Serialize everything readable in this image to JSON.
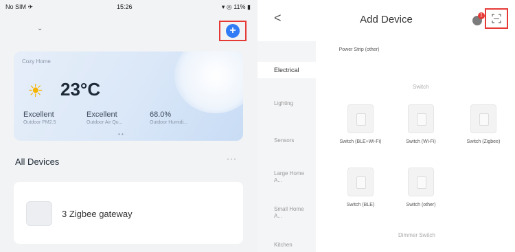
{
  "left": {
    "statusbar": {
      "left": "No SIM ✈",
      "time": "15:26",
      "right": "▾ ◎ 11% ▮"
    },
    "home_chevron": "⌄",
    "weather": {
      "home_label": "Cozy Home",
      "temperature": "23°C",
      "stats": [
        {
          "value": "Excellent",
          "label": "Outdoor PM2.5"
        },
        {
          "value": "Excellent",
          "label": "Outdoor Air Qu..."
        },
        {
          "value": "68.0%",
          "label": "Outdoor Humidi..."
        }
      ],
      "dots": "• •"
    },
    "all_devices_label": "All Devices",
    "more_label": "···",
    "devices": [
      {
        "name": "3 Zigbee gateway"
      }
    ]
  },
  "right": {
    "back": "<",
    "title": "Add Device",
    "badge": "1",
    "sidebar": [
      "Electrical",
      "Lighting",
      "Sensors",
      "Large Home A...",
      "Small Home A...",
      "Kitchen"
    ],
    "top_item": "Power Strip (other)",
    "section_switch": "Switch",
    "section_dimmer": "Dimmer Switch",
    "switch_items": [
      {
        "label": "Switch (BLE+Wi-Fi)"
      },
      {
        "label": "Switch (Wi-Fi)"
      },
      {
        "label": "Switch (Zigbee)"
      },
      {
        "label": "Switch (BLE)"
      },
      {
        "label": "Switch (other)"
      }
    ]
  },
  "colors": {
    "accent_blue": "#2f7cf6",
    "highlight_red": "#e53935",
    "sun": "#f6b400"
  },
  "icons": {
    "add": "plus-circle-icon",
    "scan": "scan-icon",
    "back": "chevron-left-icon",
    "sun": "sun-icon"
  }
}
